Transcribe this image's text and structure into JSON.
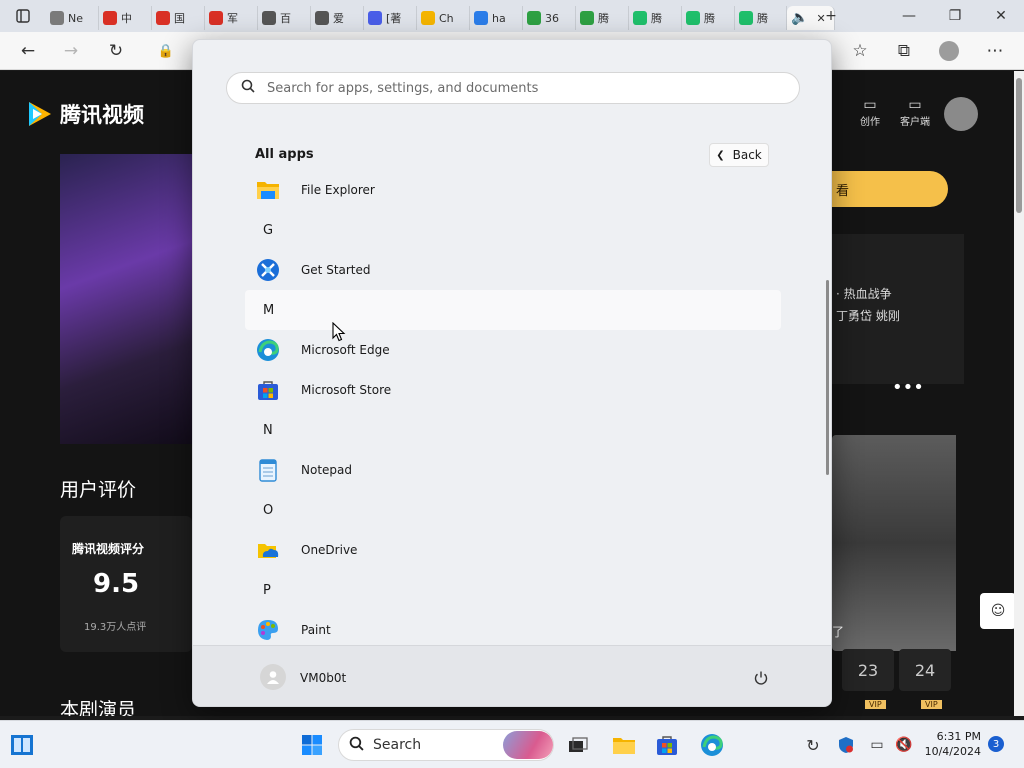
{
  "browser": {
    "tabs": [
      {
        "label": "Ne",
        "color": "#7a7a7a"
      },
      {
        "label": "中",
        "color": "#d93025"
      },
      {
        "label": "国",
        "color": "#d93025"
      },
      {
        "label": "军",
        "color": "#d93025"
      },
      {
        "label": "百",
        "color": "#555555"
      },
      {
        "label": "爱",
        "color": "#555555"
      },
      {
        "label": "[著",
        "color": "#4a5ee8"
      },
      {
        "label": "Ch",
        "color": "#f4b400"
      },
      {
        "label": "ha",
        "color": "#2b7de9"
      },
      {
        "label": "36",
        "color": "#2ea043"
      },
      {
        "label": "腾",
        "color": "#2ea043"
      },
      {
        "label": "腾",
        "color": "#1fbf6b"
      },
      {
        "label": "腾",
        "color": "#1fbf6b"
      },
      {
        "label": "腾",
        "color": "#1fbf6b"
      }
    ]
  },
  "page": {
    "logo_text": "腾讯视频",
    "nav_create": "创作",
    "nav_client": "客户端",
    "watch_btn": "看",
    "side_text_1": "· 热血战争",
    "side_text_2": "丁勇岱 姚刚",
    "side_caption": "了",
    "ep_23": "23",
    "ep_24": "24",
    "vip": "VIP",
    "section_reviews": "用户评价",
    "rating_label": "腾讯视频评分",
    "rating_value": "9.5",
    "rating_count": "19.3万人点评",
    "section_cast": "本剧演员"
  },
  "start_menu": {
    "search_placeholder": "Search for apps, settings, and documents",
    "all_apps_label": "All apps",
    "back_label": "Back",
    "items": [
      {
        "type": "app",
        "name": "File Explorer",
        "icon": "folder-icon"
      },
      {
        "type": "letter",
        "name": "G"
      },
      {
        "type": "app",
        "name": "Get Started",
        "icon": "get-started-icon"
      },
      {
        "type": "letter",
        "name": "M"
      },
      {
        "type": "app",
        "name": "Microsoft Edge",
        "icon": "edge-icon"
      },
      {
        "type": "app",
        "name": "Microsoft Store",
        "icon": "store-icon"
      },
      {
        "type": "letter",
        "name": "N"
      },
      {
        "type": "app",
        "name": "Notepad",
        "icon": "notepad-icon"
      },
      {
        "type": "letter",
        "name": "O"
      },
      {
        "type": "app",
        "name": "OneDrive",
        "icon": "onedrive-icon"
      },
      {
        "type": "letter",
        "name": "P"
      },
      {
        "type": "app",
        "name": "Paint",
        "icon": "paint-icon"
      }
    ],
    "user_name": "VM0b0t"
  },
  "taskbar": {
    "search_label": "Search",
    "time": "6:31 PM",
    "date": "10/4/2024",
    "notification_count": "3"
  }
}
